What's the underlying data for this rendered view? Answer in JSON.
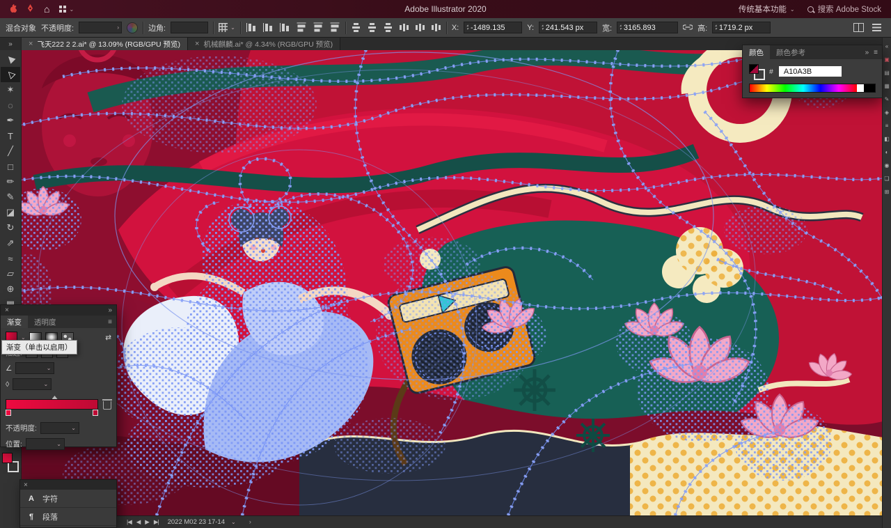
{
  "colors": {
    "accent_red": "#E0103C",
    "hex_swatch": "#A10A3B",
    "canvas_bg": "#C01236",
    "selection_blue": "#6F8CF2"
  },
  "icons": {
    "up": "▴",
    "down": "▾",
    "chevron": "⌄",
    "collapse": "»",
    "menu": "≡",
    "close": "×",
    "arrow": "›",
    "combo": "⌄"
  },
  "menubar": {
    "title": "Adobe Illustrator 2020",
    "workspace": "传统基本功能",
    "search": "搜索 Adobe Stock",
    "home_glyph": "⌂"
  },
  "controlbar": {
    "selection_type": "混合对象",
    "opacity_label": "不透明度:",
    "opacity_value": "",
    "corner_label": "边角:",
    "corner_value": "",
    "x_label": "X:",
    "x_value": "-1489.135",
    "y_label": "Y:",
    "y_value": "241.543 px",
    "w_label": "宽:",
    "w_value": "3165.893",
    "h_label": "高:",
    "h_value": "1719.2 px",
    "align_icons": [
      {
        "name": "align-left-icon",
        "cls": "av"
      },
      {
        "name": "align-h-center-icon",
        "cls": "av"
      },
      {
        "name": "align-right-icon",
        "cls": "av"
      },
      {
        "name": "align-top-icon",
        "cls": "ah"
      },
      {
        "name": "align-v-center-icon",
        "cls": "ah"
      },
      {
        "name": "align-bottom-icon",
        "cls": "ah"
      }
    ],
    "distribute_icons": [
      {
        "name": "distribute-top-icon",
        "cls": "dh"
      },
      {
        "name": "distribute-v-center-icon",
        "cls": "dh"
      },
      {
        "name": "distribute-bottom-icon",
        "cls": "dh"
      },
      {
        "name": "distribute-left-icon",
        "cls": "dv"
      },
      {
        "name": "distribute-h-center-icon",
        "cls": "dv"
      },
      {
        "name": "distribute-right-icon",
        "cls": "dv"
      }
    ]
  },
  "tabs": [
    {
      "name": "tab-feitian",
      "label": "飞天222 2 2.ai* @ 13.09% (RGB/GPU 预览)",
      "close": "×",
      "active": true
    },
    {
      "name": "tab-jixieqilin",
      "label": "机械麒麟.ai* @ 4.34% (RGB/GPU 预览)",
      "close": "×"
    }
  ],
  "tools": [
    {
      "name": "selection-tool",
      "glyph": "▶",
      "cls": "rcur"
    },
    {
      "name": "direct-selection-tool",
      "glyph": "▷",
      "cls": "rcur",
      "active": true
    },
    {
      "name": "magic-wand-tool",
      "glyph": "✶"
    },
    {
      "name": "lasso-tool",
      "glyph": "◌"
    },
    {
      "name": "pen-tool",
      "glyph": "✒"
    },
    {
      "name": "type-tool",
      "glyph": "T"
    },
    {
      "name": "line-segment-tool",
      "glyph": "╱"
    },
    {
      "name": "rectangle-tool",
      "glyph": "□"
    },
    {
      "name": "paintbrush-tool",
      "glyph": "✏"
    },
    {
      "name": "pencil-tool",
      "glyph": "✎"
    },
    {
      "name": "eraser-tool",
      "glyph": "◪"
    },
    {
      "name": "rotate-tool",
      "glyph": "↻"
    },
    {
      "name": "scale-tool",
      "glyph": "⇗"
    },
    {
      "name": "width-tool",
      "glyph": "≈"
    },
    {
      "name": "free-transform-tool",
      "glyph": "▱"
    },
    {
      "name": "shape-builder-tool",
      "glyph": "⊕"
    },
    {
      "name": "mesh-tool",
      "glyph": "▦"
    },
    {
      "name": "gradient-tool",
      "glyph": "◧"
    },
    {
      "name": "eyedropper-tool",
      "glyph": "✦"
    },
    {
      "name": "blend-tool",
      "glyph": "◎"
    },
    {
      "name": "symbol-sprayer-tool",
      "glyph": "☁"
    },
    {
      "name": "column-graph-tool",
      "glyph": "▥"
    },
    {
      "name": "artboard-tool",
      "glyph": "▣"
    },
    {
      "name": "slice-tool",
      "glyph": "✂"
    },
    {
      "name": "zoom-tool",
      "glyph": "⚲"
    }
  ],
  "dock": [
    {
      "name": "collapse-panels-icon",
      "glyph": "«"
    },
    {
      "name": "color-panel-icon",
      "glyph": "▣",
      "cls": "red"
    },
    {
      "name": "color-guide-panel-icon",
      "glyph": "▤"
    },
    {
      "name": "swatches-panel-icon",
      "glyph": "▦"
    },
    {
      "name": "brushes-panel-icon",
      "glyph": "✎"
    },
    {
      "name": "symbols-panel-icon",
      "glyph": "◈"
    },
    {
      "name": "stroke-panel-icon",
      "glyph": "≡"
    },
    {
      "name": "gradient-panel-icon",
      "glyph": "◧"
    },
    {
      "name": "transparency-panel-icon",
      "glyph": "◐"
    },
    {
      "name": "appearance-panel-icon",
      "glyph": "◉"
    },
    {
      "name": "layers-panel-icon",
      "glyph": "❏"
    },
    {
      "name": "artboards-panel-icon",
      "glyph": "⊞"
    }
  ],
  "color_panel": {
    "tabs": [
      {
        "name": "color-tab",
        "label": "颜色",
        "active": true
      },
      {
        "name": "color-guide-tab",
        "label": "颜色参考"
      }
    ],
    "hex_label": "#",
    "hex_value": "A10A3B"
  },
  "gradient_panel": {
    "tabs": [
      {
        "name": "gradient-tab",
        "label": "渐变",
        "active": true
      },
      {
        "name": "transparency-tab",
        "label": "透明度"
      }
    ],
    "tooltip": "渐变（单击以启用）",
    "stroke_label": "描边:",
    "opacity_label": "不透明度:",
    "position_label": "位置:",
    "angle_glyph": "∠",
    "aspect_glyph": "◊",
    "reverse_glyph": "⇄"
  },
  "type_panel": {
    "rows": [
      {
        "name": "character-row",
        "icon": "A",
        "label": "字符"
      },
      {
        "name": "paragraph-row",
        "icon": "¶",
        "label": "段落"
      }
    ]
  },
  "statusbar": {
    "nav": [
      {
        "name": "first-artboard-icon",
        "glyph": "|◀"
      },
      {
        "name": "prev-artboard-icon",
        "glyph": "◀"
      },
      {
        "name": "next-artboard-icon",
        "glyph": "▶"
      },
      {
        "name": "last-artboard-icon",
        "glyph": "▶|"
      }
    ],
    "status_text": "2022 M02 23 17-14"
  }
}
